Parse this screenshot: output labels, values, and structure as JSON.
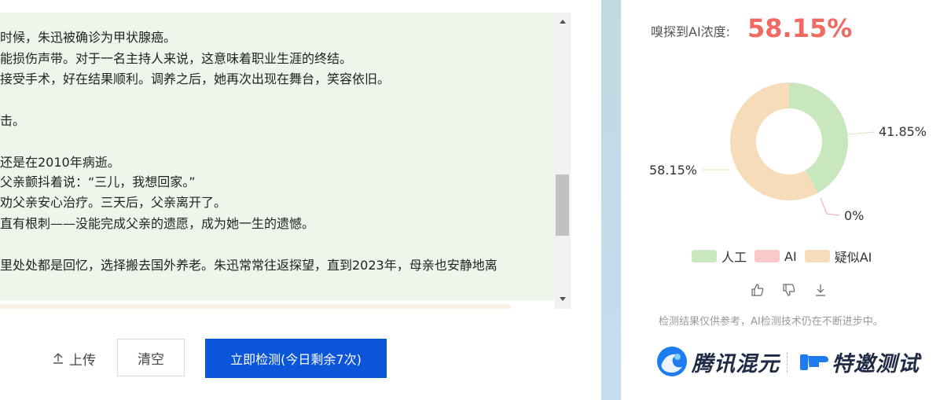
{
  "editor": {
    "lines": [
      "时候，朱迅被确诊为甲状腺癌。",
      "能损伤声带。对于一名主持人来说，这意味着职业生涯的终结。",
      "接受手术，好在结果顺利。调养之后，她再次出现在舞台，笑容依旧。",
      "",
      "击。",
      "",
      "还是在2010年病逝。",
      "父亲颤抖着说：“三儿，我想回家。”",
      "劝父亲安心治疗。三天后，父亲离开了。",
      "直有根刺——没能完成父亲的遗愿，成为她一生的遗憾。",
      "",
      "里处处都是回忆，选择搬去国外养老。朱迅常常往返探望，直到2023年，母亲也安静地离"
    ]
  },
  "actions": {
    "upload_label": "上传",
    "clear_label": "清空",
    "detect_label": "立即检测(今日剩余7次)"
  },
  "result": {
    "score_label": "嗅探到AI浓度:",
    "score_value": "58.15%",
    "disclaimer": "检测结果仅供参考，AI检测技术仍在不断进步中。"
  },
  "chart_data": {
    "type": "pie",
    "donut": true,
    "categories": [
      "人工",
      "AI",
      "疑似AI"
    ],
    "values": [
      41.85,
      0,
      58.15
    ],
    "labels": [
      "41.85%",
      "0%",
      "58.15%"
    ],
    "colors": [
      "#c9e7bd",
      "#f9c8c8",
      "#f6dcb9"
    ],
    "legend_position": "bottom"
  },
  "logos": {
    "hunyuan_text": "腾讯混元",
    "invite_text": "特邀测试"
  },
  "icons": {
    "upload": "upload-icon",
    "like": "thumbs-up-icon",
    "dislike": "thumbs-down-icon",
    "download": "download-icon"
  }
}
